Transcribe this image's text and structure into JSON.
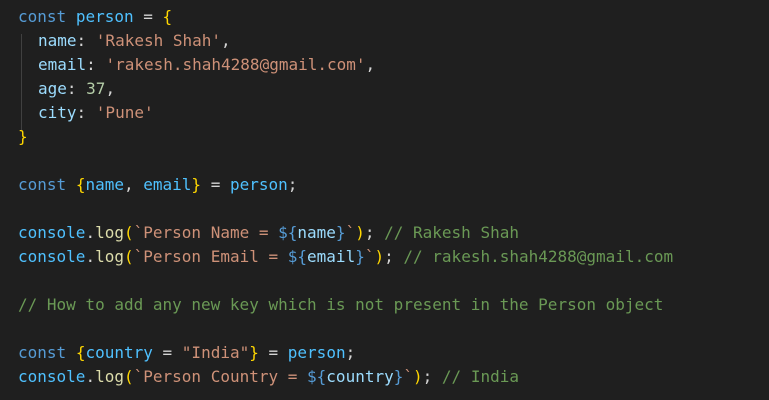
{
  "code": {
    "l1": {
      "kw": "const",
      "var": "person",
      "op": " = ",
      "brace": "{"
    },
    "l2": {
      "key": "name",
      "colon": ": ",
      "val": "'Rakesh Shah'",
      "comma": ","
    },
    "l3": {
      "key": "email",
      "colon": ": ",
      "val": "'rakesh.shah4288@gmail.com'",
      "comma": ","
    },
    "l4": {
      "key": "age",
      "colon": ": ",
      "val": "37",
      "comma": ","
    },
    "l5": {
      "key": "city",
      "colon": ": ",
      "val": "'Pune'"
    },
    "l6": {
      "brace": "}"
    },
    "l8": {
      "kw": "const",
      "open": "{",
      "a": "name",
      "sep": ", ",
      "b": "email",
      "close": "}",
      "op": " = ",
      "rhs": "person",
      "semi": ";"
    },
    "l10": {
      "obj": "console",
      "dot": ".",
      "fn": "log",
      "open": "(",
      "tick1": "`",
      "text": "Person Name = ",
      "tplopen": "${",
      "tplvar": "name",
      "tplclose": "}",
      "tick2": "`",
      "close": ")",
      "semi": "; ",
      "comment": "// Rakesh Shah"
    },
    "l11": {
      "obj": "console",
      "dot": ".",
      "fn": "log",
      "open": "(",
      "tick1": "`",
      "text": "Person Email = ",
      "tplopen": "${",
      "tplvar": "email",
      "tplclose": "}",
      "tick2": "`",
      "close": ")",
      "semi": "; ",
      "comment": "// rakesh.shah4288@gmail.com"
    },
    "l13": {
      "comment": "// How to add any new key which is not present in the Person object"
    },
    "l15": {
      "kw": "const",
      "open": "{",
      "key": "country",
      "op1": " = ",
      "default": "\"India\"",
      "close": "}",
      "op": " = ",
      "rhs": "person",
      "semi": ";"
    },
    "l16": {
      "obj": "console",
      "dot": ".",
      "fn": "log",
      "open": "(",
      "tick1": "`",
      "text": "Person Country = ",
      "tplopen": "${",
      "tplvar": "country",
      "tplclose": "}",
      "tick2": "`",
      "close": ")",
      "semi": "; ",
      "comment": "// India"
    }
  },
  "colors": {
    "background": "#1f1f1f",
    "keyword": "#569cd6",
    "variable": "#4fc1ff",
    "property": "#9cdcfe",
    "string": "#ce9178",
    "number": "#b5cea8",
    "function": "#dcdcaa",
    "comment": "#6a9955",
    "bracket1": "#ffd700",
    "bracket2": "#da70d6"
  }
}
